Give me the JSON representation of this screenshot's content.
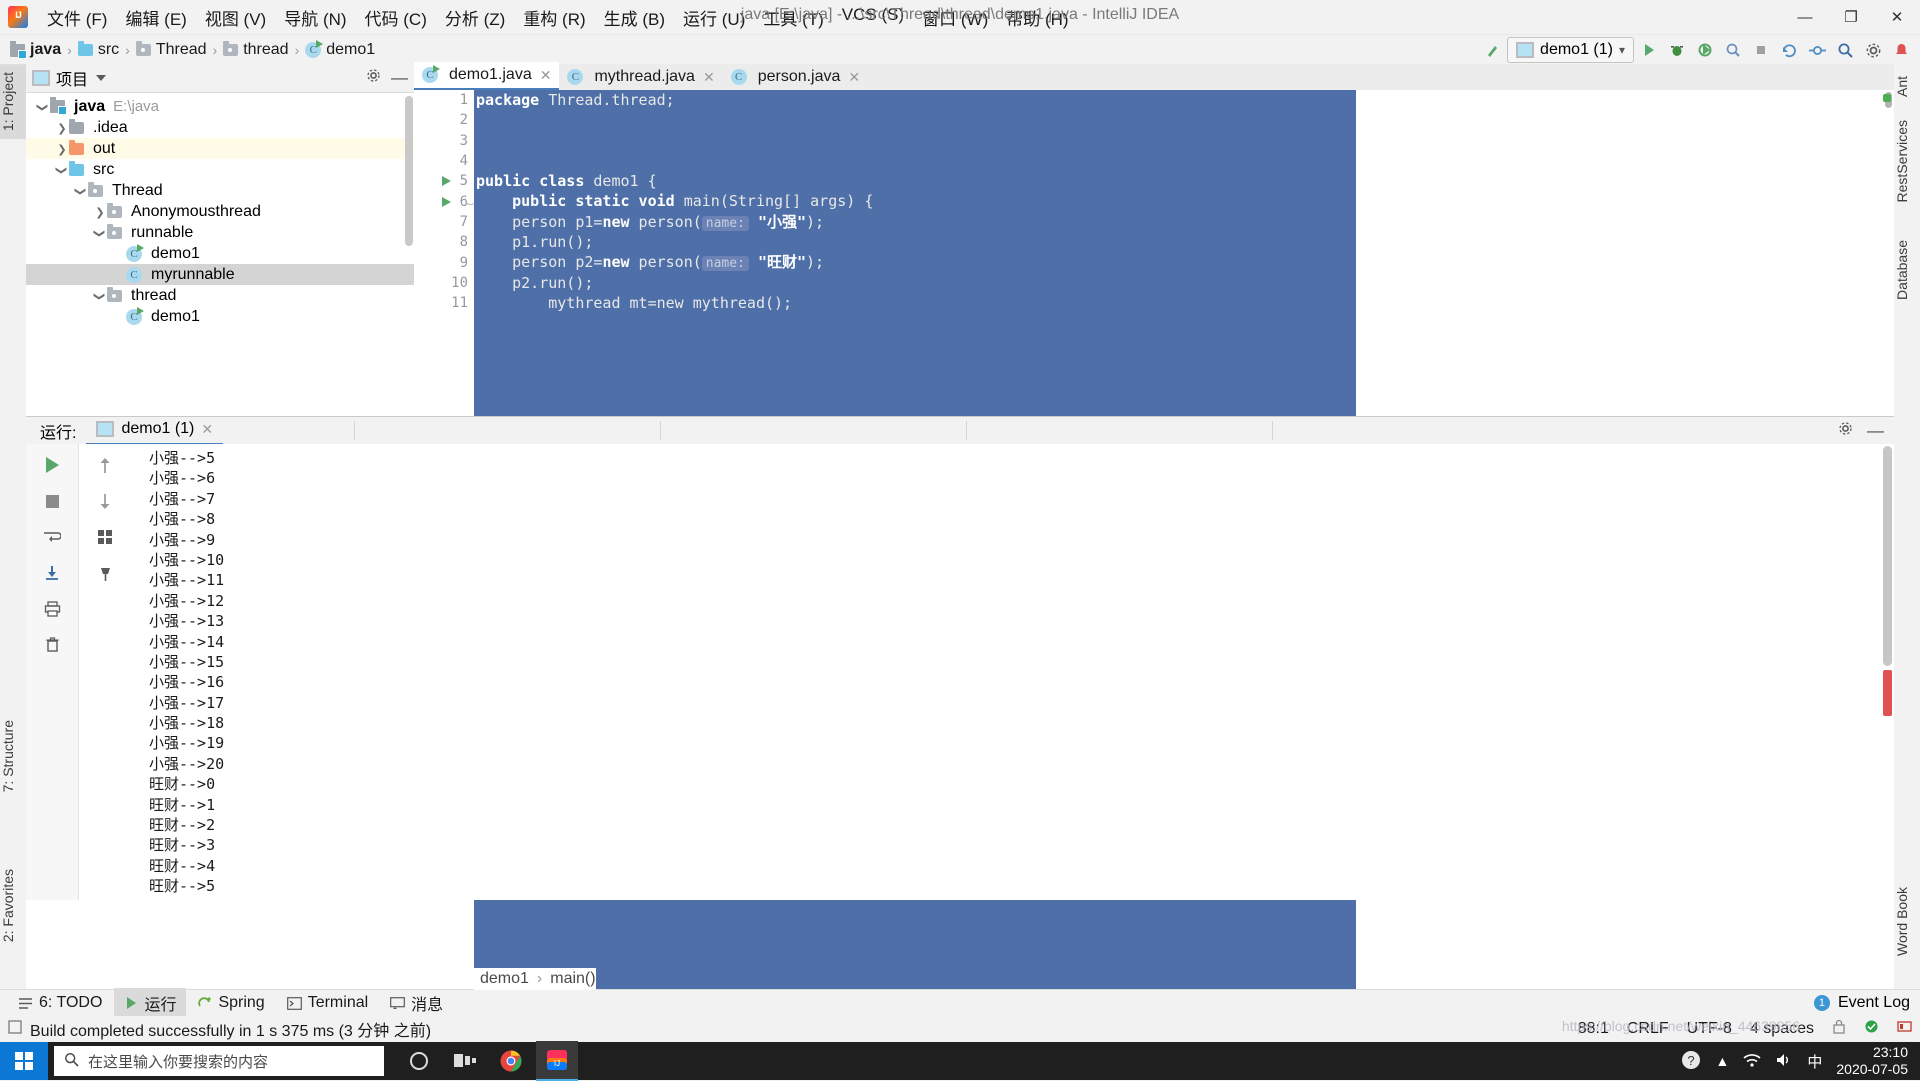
{
  "window": {
    "title": "java [E:\\java] - ...\\src\\Thread\\thread\\demo1.java - IntelliJ IDEA",
    "minimize": "—",
    "maximize": "❐",
    "close": "✕"
  },
  "menu": {
    "items": [
      "文件 (F)",
      "编辑 (E)",
      "视图 (V)",
      "导航 (N)",
      "代码 (C)",
      "分析 (Z)",
      "重构 (R)",
      "生成 (B)",
      "运行 (U)",
      "工具 (T)",
      "VCS (S)",
      "窗口 (W)",
      "帮助 (H)"
    ]
  },
  "navbar": {
    "breadcrumb": [
      "java",
      "src",
      "Thread",
      "thread",
      "demo1"
    ],
    "separator": "›",
    "run_config": "demo1 (1)",
    "icons": [
      "build-icon",
      "run-icon",
      "debug-icon",
      "run-coverage-icon",
      "profiler-icon",
      "stop-icon",
      "update-project-icon",
      "commit-icon",
      "search-everywhere-icon",
      "settings-icon",
      "notifications-icon"
    ]
  },
  "left_tool_tabs": [
    {
      "label": "1: Project",
      "selected": true
    }
  ],
  "left_tool_tabs_lower": [
    {
      "label": "7: Structure"
    },
    {
      "label": "2: Favorites"
    }
  ],
  "right_tool_tabs": [
    {
      "label": "Ant"
    },
    {
      "label": "RestServices"
    },
    {
      "label": "Database"
    },
    {
      "label": "Word Book"
    }
  ],
  "project_panel": {
    "title": "项目",
    "tree": [
      {
        "indent": 0,
        "arrow": "down",
        "icon": "module-icon",
        "label": "java",
        "path": "E:\\java",
        "bold": true,
        "state": "normal"
      },
      {
        "indent": 1,
        "arrow": "right",
        "icon": "folder-grey",
        "label": ".idea",
        "path": "",
        "bold": false,
        "state": "normal"
      },
      {
        "indent": 1,
        "arrow": "right",
        "icon": "folder-orange",
        "label": "out",
        "path": "",
        "bold": false,
        "state": "yellow"
      },
      {
        "indent": 1,
        "arrow": "down",
        "icon": "folder-blue",
        "label": "src",
        "path": "",
        "bold": false,
        "state": "normal"
      },
      {
        "indent": 2,
        "arrow": "down",
        "icon": "package-icon",
        "label": "Thread",
        "path": "",
        "bold": false,
        "state": "normal"
      },
      {
        "indent": 3,
        "arrow": "right",
        "icon": "package-icon",
        "label": "Anonymousthread",
        "path": "",
        "bold": false,
        "state": "normal"
      },
      {
        "indent": 3,
        "arrow": "down",
        "icon": "package-icon",
        "label": "runnable",
        "path": "",
        "bold": false,
        "state": "normal"
      },
      {
        "indent": 4,
        "arrow": "none",
        "icon": "class-runnable-icon",
        "label": "demo1",
        "path": "",
        "bold": false,
        "state": "normal"
      },
      {
        "indent": 4,
        "arrow": "none",
        "icon": "class-icon",
        "label": "myrunnable",
        "path": "",
        "bold": false,
        "state": "selected"
      },
      {
        "indent": 3,
        "arrow": "down",
        "icon": "package-icon",
        "label": "thread",
        "path": "",
        "bold": false,
        "state": "normal"
      },
      {
        "indent": 4,
        "arrow": "none",
        "icon": "class-runnable-icon",
        "label": "demo1",
        "path": "",
        "bold": false,
        "state": "normal"
      }
    ]
  },
  "editor": {
    "tabs": [
      {
        "label": "demo1.java",
        "icon": "class-runnable-icon",
        "active": true,
        "close": "✕"
      },
      {
        "label": "mythread.java",
        "icon": "class-icon",
        "active": false,
        "close": "✕"
      },
      {
        "label": "person.java",
        "icon": "class-icon",
        "active": false,
        "close": "✕"
      }
    ],
    "line_numbers": [
      "1",
      "2",
      "3",
      "4",
      "5",
      "6",
      "7",
      "8",
      "9",
      "10",
      "11"
    ],
    "gutter_run_lines": [
      5,
      6
    ],
    "fold_lines": [
      6
    ],
    "lines": [
      {
        "n": 1,
        "segments": [
          {
            "t": "package",
            "c": "kw"
          },
          {
            "t": " Thread.thread;",
            "c": "plain"
          }
        ]
      },
      {
        "n": 2,
        "segments": []
      },
      {
        "n": 3,
        "segments": []
      },
      {
        "n": 4,
        "segments": []
      },
      {
        "n": 5,
        "segments": [
          {
            "t": "public class",
            "c": "kw"
          },
          {
            "t": " demo1 {",
            "c": "plain"
          }
        ]
      },
      {
        "n": 6,
        "segments": [
          {
            "t": "    ",
            "c": "plain"
          },
          {
            "t": "public static void",
            "c": "kw"
          },
          {
            "t": " main(String[] args) {",
            "c": "plain"
          }
        ]
      },
      {
        "n": 7,
        "segments": [
          {
            "t": "    person p1=",
            "c": "plain"
          },
          {
            "t": "new",
            "c": "kw"
          },
          {
            "t": " person(",
            "c": "plain"
          },
          {
            "t": "name:",
            "c": "hint"
          },
          {
            "t": " ",
            "c": "plain"
          },
          {
            "t": "\"小强\"",
            "c": "str"
          },
          {
            "t": ");",
            "c": "plain"
          }
        ]
      },
      {
        "n": 8,
        "segments": [
          {
            "t": "    p1.run();",
            "c": "plain"
          }
        ]
      },
      {
        "n": 9,
        "segments": [
          {
            "t": "    person p2=",
            "c": "plain"
          },
          {
            "t": "new",
            "c": "kw"
          },
          {
            "t": " person(",
            "c": "plain"
          },
          {
            "t": "name:",
            "c": "hint"
          },
          {
            "t": " ",
            "c": "plain"
          },
          {
            "t": "\"旺财\"",
            "c": "str"
          },
          {
            "t": ");",
            "c": "plain"
          }
        ]
      },
      {
        "n": 10,
        "segments": [
          {
            "t": "    p2.run();",
            "c": "plain"
          }
        ]
      },
      {
        "n": 11,
        "segments": [
          {
            "t": "        mythread mt=new mythread();",
            "c": "plain"
          }
        ]
      }
    ],
    "breadcrumb": [
      "demo1",
      "main()"
    ],
    "breadcrumb_separator": "›"
  },
  "run_panel": {
    "label": "运行:",
    "tab": "demo1 (1)",
    "tab_close": "✕",
    "tools": [
      "rerun-icon",
      "stop-icon",
      "up-arrow-icon",
      "down-arrow-icon",
      "soft-wrap-icon",
      "scroll-to-end-icon",
      "print-icon",
      "pin-icon",
      "trash-icon"
    ],
    "settings_icon": "gear-icon",
    "minimize_icon": "minimize-icon",
    "console_lines": [
      "小强-->5",
      "小强-->6",
      "小强-->7",
      "小强-->8",
      "小强-->9",
      "小强-->10",
      "小强-->11",
      "小强-->12",
      "小强-->13",
      "小强-->14",
      "小强-->15",
      "小强-->16",
      "小强-->17",
      "小强-->18",
      "小强-->19",
      "小强-->20",
      "旺财-->0",
      "旺财-->1",
      "旺财-->2",
      "旺财-->3",
      "旺财-->4",
      "旺财-->5"
    ]
  },
  "bottom_tabs": [
    {
      "label": "6: TODO",
      "icon": "todo-icon",
      "active": false
    },
    {
      "label": "运行",
      "icon": "run-icon",
      "active": true
    },
    {
      "label": "Spring",
      "icon": "spring-icon",
      "active": false
    },
    {
      "label": "Terminal",
      "icon": "terminal-icon",
      "active": false
    },
    {
      "label": "消息",
      "icon": "messages-icon",
      "active": false
    }
  ],
  "event_log": {
    "label": "Event Log",
    "badge": "1"
  },
  "status_bar": {
    "message": "Build completed successfully in 1 s 375 ms (3 分钟 之前)",
    "caret": "88:1",
    "line_sep": "CRLF",
    "encoding": "UTF-8",
    "indent": "4 spaces",
    "icons": [
      "lock-icon",
      "git-branch-icon",
      "memory-icon"
    ]
  },
  "taskbar": {
    "search_placeholder": "在这里输入你要搜索的内容",
    "search_icon": "search-icon",
    "start_icon": "windows-start-icon",
    "items": [
      "cortana-icon",
      "task-view-icon",
      "chrome-icon",
      "intellij-icon"
    ],
    "tray": [
      "help-icon",
      "chevron-up-icon",
      "network-icon",
      "volume-icon",
      "ime-icon"
    ],
    "time": "23:10",
    "date": "2020-07-05"
  },
  "watermark": "https://blog.csdn.net/weixin_44639856"
}
